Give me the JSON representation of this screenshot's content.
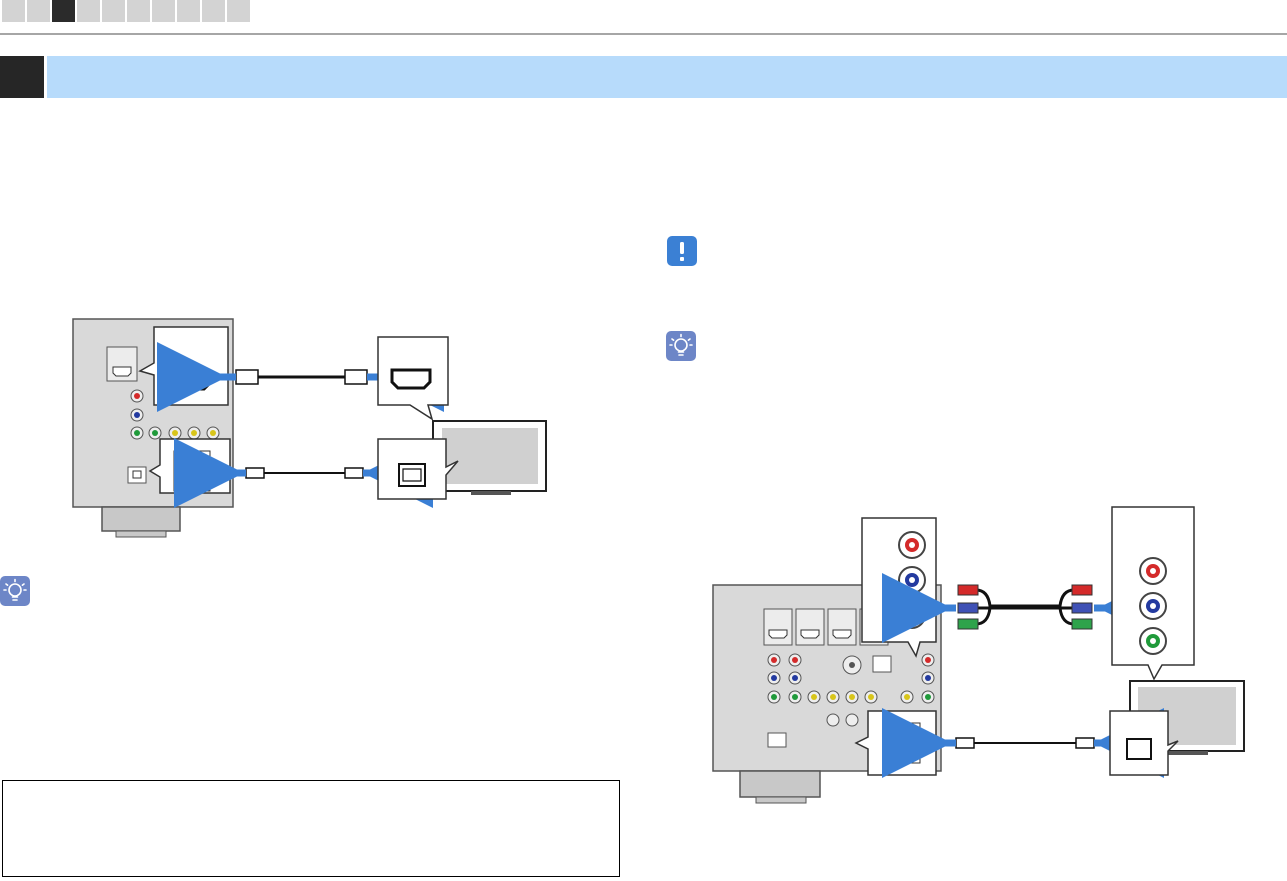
{
  "page": {
    "steps_total": 10,
    "steps_active_index": 2
  },
  "icons": {
    "note": "exclamation-icon",
    "tip": "lightbulb-icon"
  },
  "colors": {
    "header_bar": "#b7dbfb",
    "header_number_block": "#262626",
    "arrow": "#3a7fd5",
    "note_badge": "#3b80d4",
    "tip_badge": "#6d86c7",
    "jack_red": "#d42a2a",
    "jack_blue": "#233aa0",
    "jack_green": "#1f9a3a",
    "jack_yellow": "#d8c51a"
  }
}
